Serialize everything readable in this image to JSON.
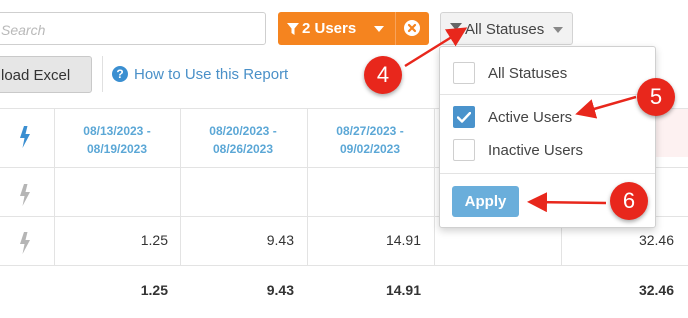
{
  "toolbar": {
    "search_placeholder": "Search",
    "users_filter_label": "2 Users",
    "status_filter_label": "All Statuses",
    "excel_button_label": "load Excel",
    "how_to_label": "How to Use this Report",
    "how_to_icon": "question-circle-icon"
  },
  "table": {
    "columns": [
      {
        "line1": "08/13/2023 -",
        "line2": "08/19/2023"
      },
      {
        "line1": "08/20/2023 -",
        "line2": "08/26/2023"
      },
      {
        "line1": "08/27/2023 -",
        "line2": "09/02/2023"
      },
      {
        "line1": "",
        "line2": ""
      },
      {
        "line1": "-",
        "line2": ""
      }
    ],
    "rows": [
      {
        "values": [
          "",
          "",
          "",
          "",
          ""
        ]
      },
      {
        "values": [
          "1.25",
          "9.43",
          "14.91",
          "",
          "32.46"
        ]
      }
    ],
    "totals": [
      "1.25",
      "9.43",
      "14.91",
      "",
      "32.46"
    ]
  },
  "status_dropdown": {
    "options": [
      {
        "label": "All Statuses",
        "checked": false
      },
      {
        "label": "Active Users",
        "checked": true
      },
      {
        "label": "Inactive Users",
        "checked": false
      }
    ],
    "apply_label": "Apply"
  },
  "annotations": [
    {
      "number": "4"
    },
    {
      "number": "5"
    },
    {
      "number": "6"
    }
  ],
  "colors": {
    "accent_orange": "#f5841f",
    "link_blue": "#4a90c8",
    "header_blue": "#5ba7d6",
    "apply_blue": "#6aaedb",
    "annotation_red": "#e8271c"
  }
}
